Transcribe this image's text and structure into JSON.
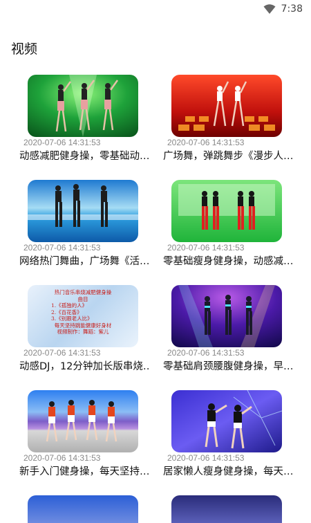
{
  "status": {
    "time": "7:38",
    "icon": "wifi-icon"
  },
  "page": {
    "title": "视频"
  },
  "videos": [
    {
      "date": "2020-07-06 14:31:53",
      "title": "动感减肥健身操，零基础动…",
      "thumb_icon": "dance-video-thumbnail"
    },
    {
      "date": "2020-07-06 14:31:53",
      "title": "广场舞，弹跳舞步《漫步人…",
      "thumb_icon": "dance-video-thumbnail"
    },
    {
      "date": "2020-07-06 14:31:53",
      "title": "网络热门舞曲，广场舞《活…",
      "thumb_icon": "dance-video-thumbnail"
    },
    {
      "date": "2020-07-06 14:31:53",
      "title": "零基础瘦身健身操，动感减…",
      "thumb_icon": "dance-video-thumbnail"
    },
    {
      "date": "2020-07-06 14:31:53",
      "title": "动感DJ，12分钟加长版串烧…",
      "thumb_icon": "playlist-thumbnail"
    },
    {
      "date": "2020-07-06 14:31:53",
      "title": "零基础肩颈腰腹健身操，早…",
      "thumb_icon": "dance-video-thumbnail"
    },
    {
      "date": "2020-07-06 14:31:53",
      "title": "新手入门健身操，每天坚持…",
      "thumb_icon": "dance-video-thumbnail"
    },
    {
      "date": "2020-07-06 14:31:53",
      "title": "居家懒人瘦身健身操，每天…",
      "thumb_icon": "dance-video-thumbnail"
    }
  ],
  "playlist_thumb": {
    "heading": "热门音乐串烧减肥健身操",
    "subheading": "曲目",
    "items": [
      "1.《孤独的人》",
      "2.《百花香》",
      "3.《别跟老人比》"
    ],
    "footer": [
      "每天坚持跳能健康好身材",
      "视频制作：舞蹈：紫儿"
    ]
  }
}
